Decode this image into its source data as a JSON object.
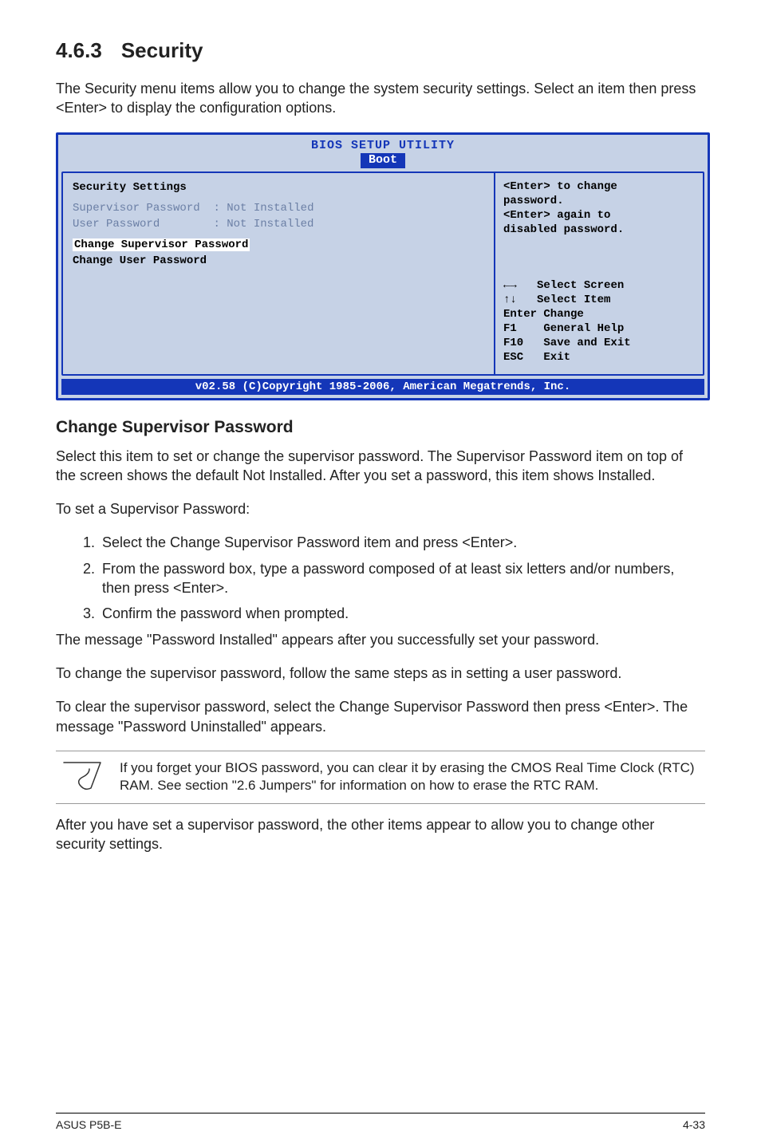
{
  "section": {
    "number": "4.6.3",
    "title": "Security"
  },
  "intro_para": "The Security menu items allow you to change the system security settings. Select an item then press <Enter> to display the configuration options.",
  "bios": {
    "title": "BIOS SETUP UTILITY",
    "tab": "Boot",
    "left": {
      "heading": "Security Settings",
      "sup_label": "Supervisor Password",
      "sup_value": ": Not Installed",
      "user_label": "User Password",
      "user_value": ": Not Installed",
      "change_sup": "Change Supervisor Password",
      "change_user": "Change User Password"
    },
    "right": {
      "help_l1": "<Enter> to change",
      "help_l2": "password.",
      "help_l3": "<Enter> again to",
      "help_l4": "disabled password.",
      "keys": {
        "select_screen": "Select Screen",
        "select_item": "Select Item",
        "enter_change": "Enter Change",
        "f1": "F1    General Help",
        "f10": "F10   Save and Exit",
        "esc": "ESC   Exit"
      }
    },
    "footer": "v02.58 (C)Copyright 1985-2006, American Megatrends, Inc."
  },
  "subhead": "Change Supervisor Password",
  "para1": "Select this item to set or change the supervisor password. The Supervisor Password item on top of the screen shows the default Not Installed. After you set a password, this item shows Installed.",
  "para2": "To set a Supervisor Password:",
  "steps": {
    "s1": "Select the Change Supervisor Password item and press <Enter>.",
    "s2": "From the password box, type a password composed of at least six letters and/or numbers, then press <Enter>.",
    "s3": "Confirm the password when prompted."
  },
  "para3": "The message \"Password Installed\" appears after you successfully set your password.",
  "para4": "To change the supervisor password, follow the same steps as in setting a user password.",
  "para5": "To clear the supervisor password, select the Change Supervisor Password then press <Enter>. The message \"Password Uninstalled\" appears.",
  "note_text": "If you forget your BIOS password, you can clear it by erasing the CMOS Real Time Clock (RTC) RAM. See section \"2.6 Jumpers\" for information on how to erase the RTC RAM.",
  "para6": "After you have set a supervisor password, the other items appear to allow you to change other security settings.",
  "footer_left": "ASUS P5B-E",
  "footer_right": "4-33"
}
